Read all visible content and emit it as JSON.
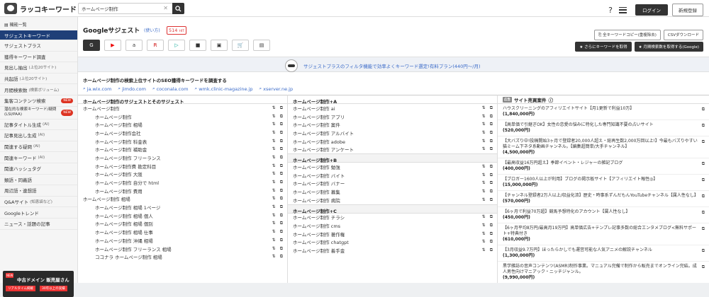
{
  "header": {
    "logo": "ラッコキーワード",
    "search_value": "ホームページ制作",
    "login": "ログイン",
    "signup": "新規登録"
  },
  "sidebar": {
    "heading": "機能一覧",
    "new_badge": "NEW",
    "items": [
      {
        "label": "サジェストキーワード",
        "sub": ""
      },
      {
        "label": "サジェストプラス",
        "sub": ""
      },
      {
        "label": "獲得キーワード調査",
        "sub": ""
      },
      {
        "label": "見出し抽出",
        "sub": "(上位20サイト)"
      },
      {
        "label": "共起語",
        "sub": "(上位20サイト)"
      },
      {
        "label": "月間検索数",
        "sub": "(検索ボリューム)"
      },
      {
        "label": "集客コンテンツ検索",
        "sub": ""
      },
      {
        "label": "潜在的な検索キーワード/疑問(LSI/PAA)",
        "sub": ""
      },
      {
        "label": "記事タイトル生成",
        "sub": "(AI)"
      },
      {
        "label": "記事見出し生成",
        "sub": "(AI)"
      },
      {
        "label": "関連する疑問",
        "sub": "(AI)"
      },
      {
        "label": "関連キーワード",
        "sub": "(AI)"
      },
      {
        "label": "関連ハッシュタグ",
        "sub": ""
      },
      {
        "label": "類語・同義語",
        "sub": ""
      },
      {
        "label": "周辺語・連想語",
        "sub": ""
      },
      {
        "label": "Q&Aサイト",
        "sub": "(知恵袋など)"
      },
      {
        "label": "Googleトレンド",
        "sub": ""
      },
      {
        "label": "ニュース・話題の記事",
        "sub": ""
      }
    ],
    "ad": {
      "r1": "NEW",
      "r2": "中古ドメイン 販売屋さん",
      "r3": "リアルタイム掲載",
      "r4": "30年以上の実績"
    }
  },
  "main": {
    "title": "Googleサジェスト",
    "how": "(使い方)",
    "count": "514",
    "count_unit": "HIT",
    "icons": [
      "G",
      "▶",
      "a",
      "R",
      "▷",
      "■",
      "▣",
      "🛒",
      "▤"
    ],
    "copy_btn": "全キーワードコピー(重複除去)",
    "csv_btn": "CSVダウンロード",
    "get_btn": "さらにキーワードを取得",
    "vol_btn": "月間検索数を取得する(Google)",
    "banner": "サジェストプラスのフィルタ機能で効率よくキーワード選定!有料プラン(440円〜/月)",
    "seo_title": "ホームページ制作の検索上位サイトのSEO獲得キーワードを調査する",
    "seo_links": [
      "ja.wix.com",
      "jimdo.com",
      "coconala.com",
      "wmk.clinic-magazine.jp",
      "xserver.ne.jp"
    ]
  },
  "col1": {
    "header": "ホームページ制作のサジェストとそのサジェスト",
    "rows": [
      {
        "t": "ホームページ制作",
        "sub": false
      },
      {
        "t": "ホームページ制作",
        "sub": true
      },
      {
        "t": "ホームページ制作 相場",
        "sub": true
      },
      {
        "t": "ホームページ制作会社",
        "sub": true
      },
      {
        "t": "ホームページ制作 科金表",
        "sub": true
      },
      {
        "t": "ホームページ制作 補助金",
        "sub": true
      },
      {
        "t": "ホームページ制作 フリーランス",
        "sub": true
      },
      {
        "t": "ホームページ制作費 勘定科目",
        "sub": true
      },
      {
        "t": "ホームページ制作 大阪",
        "sub": true
      },
      {
        "t": "ホームページ制作 自分で html",
        "sub": true
      },
      {
        "t": "ホームページ制作 費用",
        "sub": true
      },
      {
        "t": "ホームページ制作 相場",
        "sub": false
      },
      {
        "t": "ホームページ制作 相場 1ページ",
        "sub": true
      },
      {
        "t": "ホームページ制作 相場 個人",
        "sub": true
      },
      {
        "t": "ホームページ制作 相場 個別",
        "sub": true
      },
      {
        "t": "ホームページ制作 相場 仕事",
        "sub": true
      },
      {
        "t": "ホームページ制作 沖縄 相場",
        "sub": true
      },
      {
        "t": "ホームページ制作 フリーランス 相場",
        "sub": true
      },
      {
        "t": "ココナラ ホームページ制作 相場",
        "sub": true
      }
    ]
  },
  "col2": {
    "header": "ホームページ制作+A",
    "groups": [
      {
        "title": "",
        "rows": [
          "ホームページ制作 ai",
          "ホームページ制作 アプリ",
          "ホームページ制作 案件",
          "ホームページ制作 アルバイト",
          "ホームページ制作 adobe",
          "ホームページ制作 アンケート"
        ]
      },
      {
        "title": "ホームページ制作+B",
        "rows": [
          "ホームページ制作 勉強",
          "ホームページ制作 バイト",
          "ホームページ制作 バナー",
          "ホームページ制作 募集",
          "ホームページ制作 病院"
        ]
      },
      {
        "title": "ホームページ制作+C",
        "rows": [
          "ホームページ制作 チラシ",
          "ホームページ制作 cms",
          "ホームページ制作 著作権",
          "ホームページ制作 chatgpt",
          "ホームページ制作 着手金"
        ]
      }
    ]
  },
  "col3": {
    "tag": "広告",
    "header": "サイト売買案件",
    "items": [
      {
        "t": "ハウスクリーニングのアフィリエイトサイト【月1更新で利益10万】",
        "p": "(1,840,000円)"
      },
      {
        "t": "【高単価で引継ぎOK】女性の恋愛の悩みに特化した専門知識不要の占いサイト",
        "p": "(520,000円)"
      },
      {
        "t": "【大バズり中!投稿開始3ヶ月で登録者20,000人超え・総再生数2,000万回以上!】今最もバズりやすい猫ミーム下ネタ系動画チャンネル。【編集超簡単/大手チャンネル】",
        "p": "(4,500,000円)"
      },
      {
        "t": "【最高収益16万円超え】季節イベント・レジャーの雑記ブログ",
        "p": "(400,000円)"
      },
      {
        "t": "【ブロガー1600人以上が利用】ブログの掲示板サイト【アフィリエイト報性◎】",
        "p": "(15,000,000円)"
      },
      {
        "t": "【チャンネル登録者2万人以上/収益化済】歴史・時事系ずんだもんYouTubeチャンネル【属人性なし】",
        "p": "(570,000円)"
      },
      {
        "t": "【6ヶ月で利益70万超】競馬予想特化のアカウント【属人性なし】",
        "p": "(450,000円)"
      },
      {
        "t": "【6ヶ月平均8万円/最高月19万円】高単価広告+テンプレ記事多数の総合エンタメブログ<無料サポート+特典付き",
        "p": "(610,000円)"
      },
      {
        "t": "【3月収益9.7万円】ほったらかしでも運営可能な人気アニメの解説チャンネル",
        "p": "(1,300,000円)"
      },
      {
        "t": "黒学雑誌の音声コンテンツ(ASMR)制作事業。マニュアル完備で制作から販売までオンライン完結。成人男性向けマニアック・ニッチジャンル。",
        "p": "(9,990,000円)"
      }
    ]
  }
}
